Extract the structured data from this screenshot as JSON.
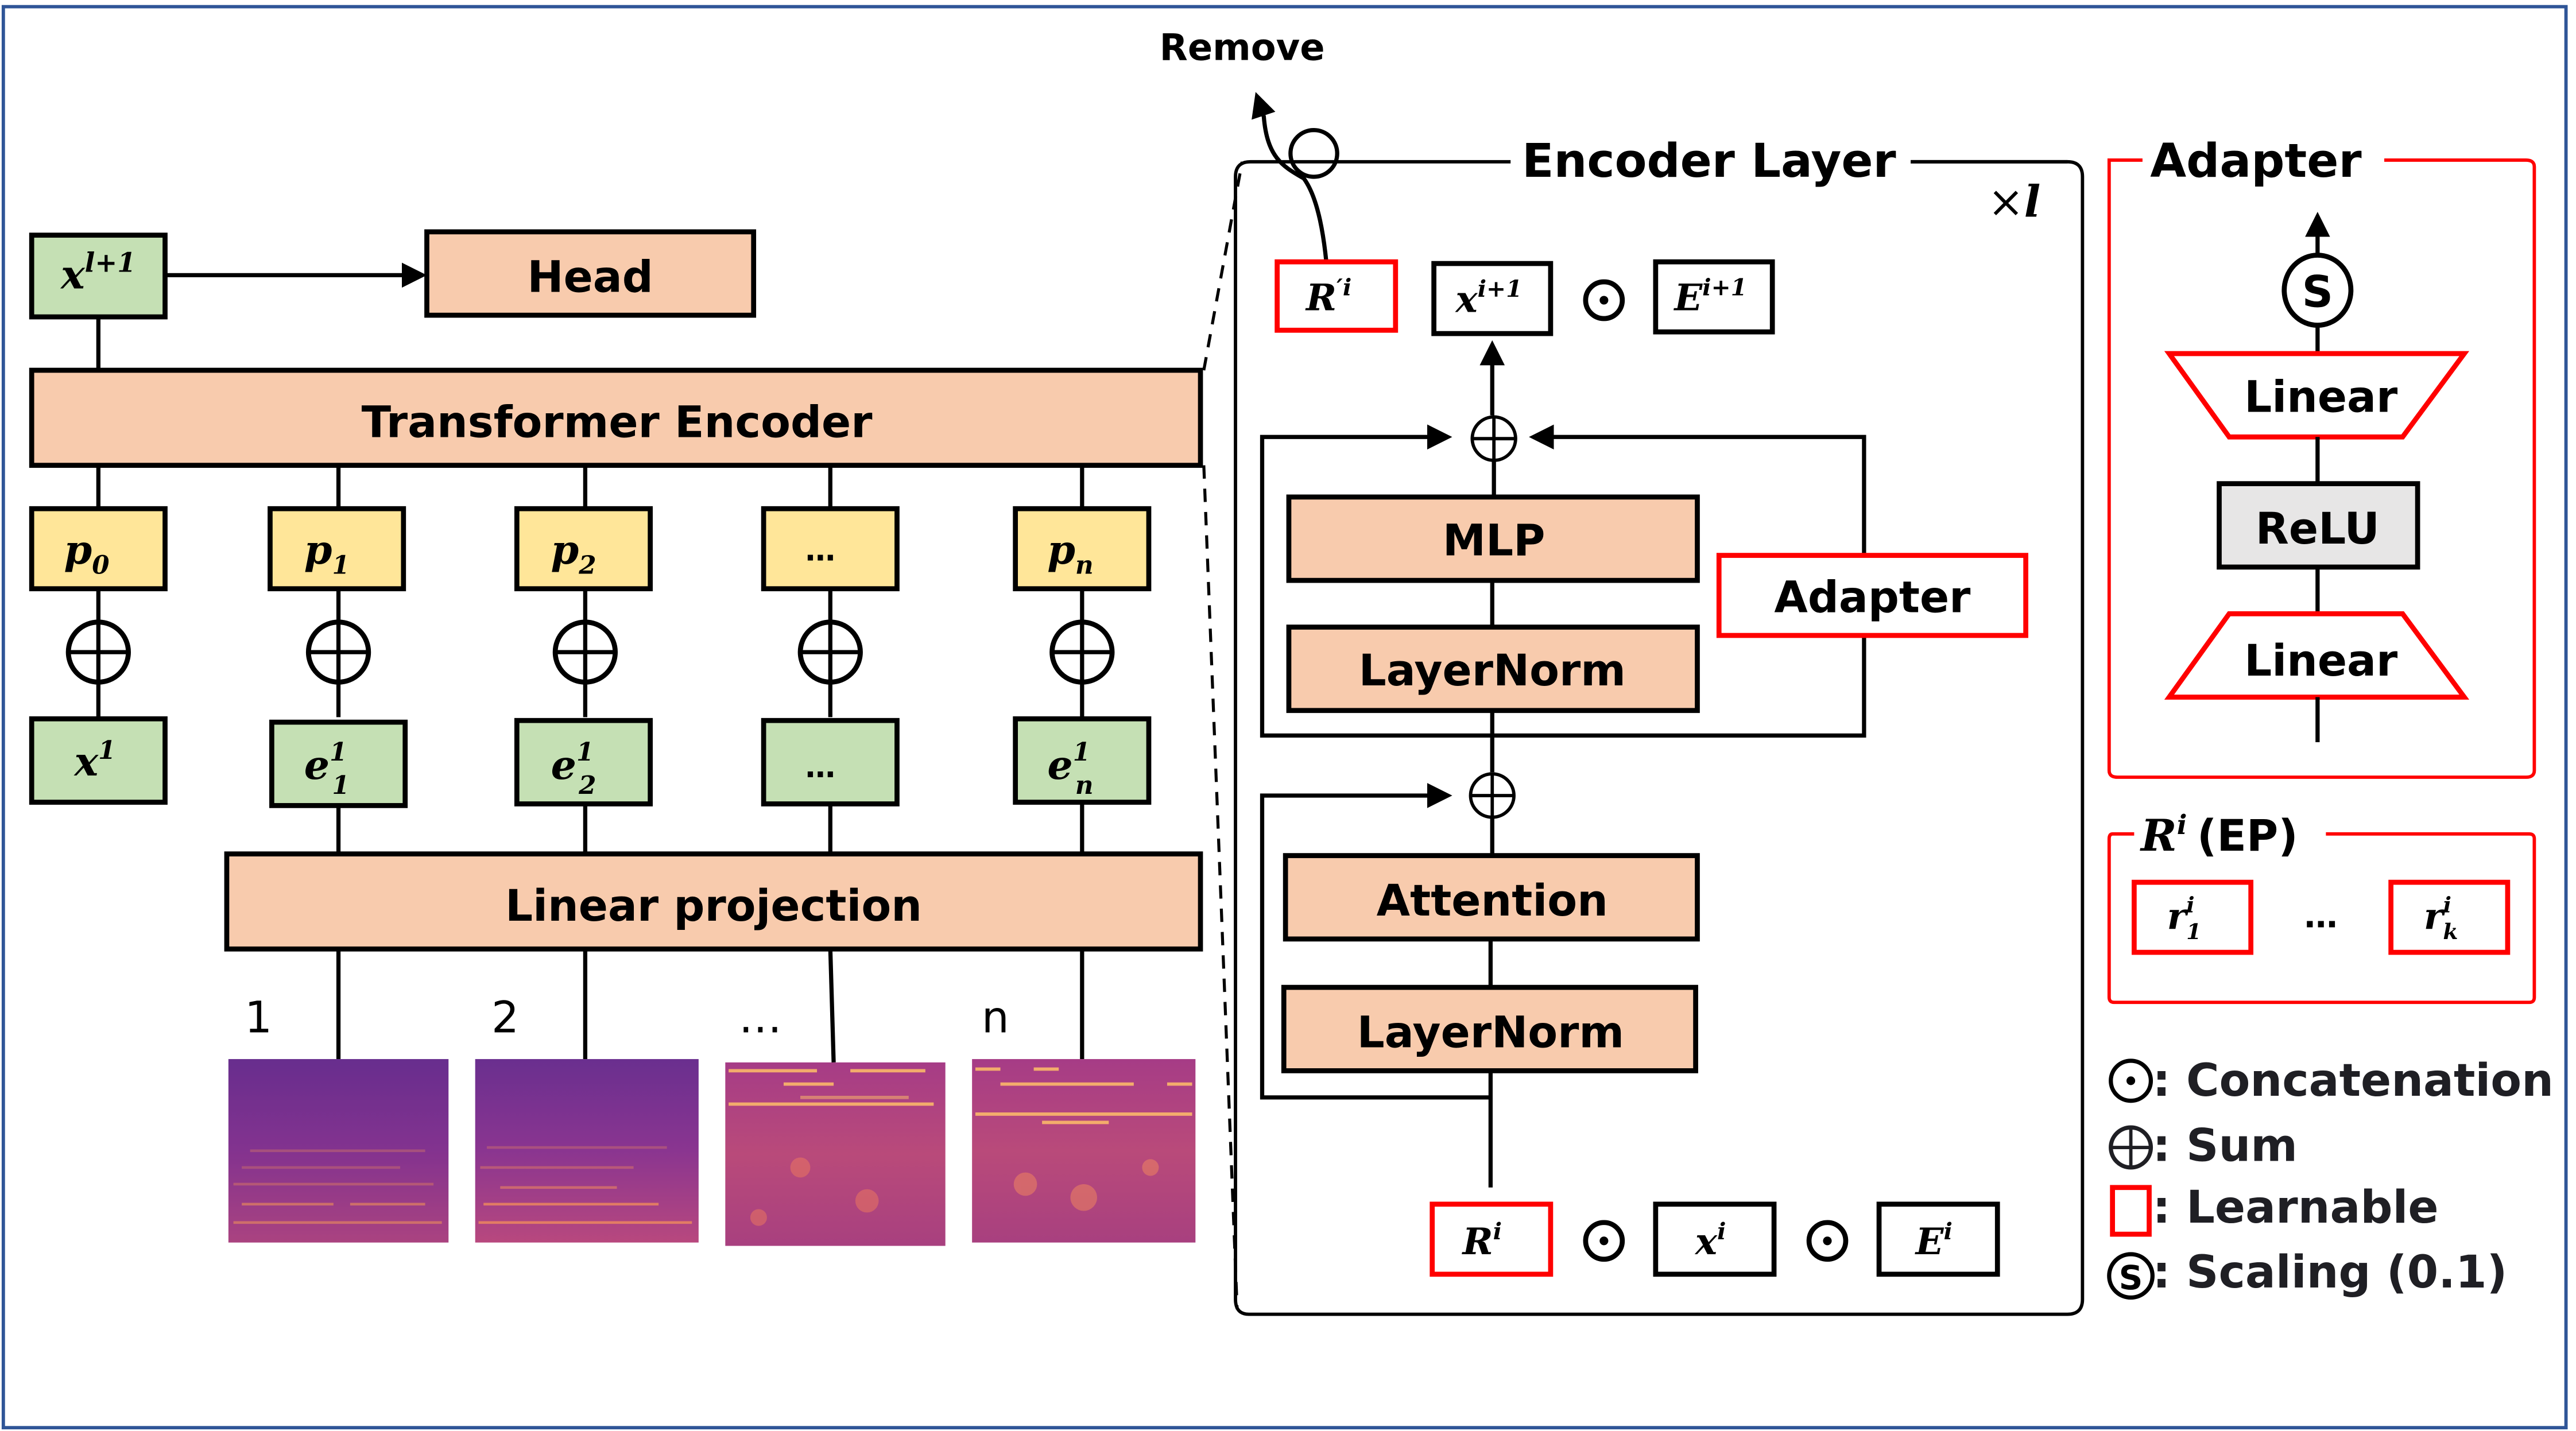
{
  "colors": {
    "frame": "#2F5597",
    "peach": "#F8CBAD",
    "green": "#C5E0B4",
    "yellow": "#FFE699",
    "learnable": "#FF0000",
    "relu": "#E7E6E6"
  },
  "left": {
    "output_token": {
      "base": "x",
      "sup": "l+1"
    },
    "head_label": "Head",
    "transformer_label": "Transformer Encoder",
    "positional": [
      {
        "base": "p",
        "sub": "0"
      },
      {
        "base": "p",
        "sub": "1"
      },
      {
        "base": "p",
        "sub": "2"
      },
      {
        "base": "…",
        "sub": ""
      },
      {
        "base": "p",
        "sub": "n"
      }
    ],
    "tokens": [
      {
        "base": "x",
        "sup": "1",
        "sub": ""
      },
      {
        "base": "e",
        "sup": "1",
        "sub": "1"
      },
      {
        "base": "e",
        "sup": "1",
        "sub": "2"
      },
      {
        "base": "…",
        "sup": "",
        "sub": ""
      },
      {
        "base": "e",
        "sup": "1",
        "sub": "n"
      }
    ],
    "projection_label": "Linear projection",
    "patch_labels": [
      "1",
      "2",
      "…",
      "n"
    ],
    "spectrogram_icons": [
      "spectrogram-patch",
      "spectrogram-patch",
      "spectrogram-patch",
      "spectrogram-patch"
    ]
  },
  "encoder": {
    "title": "Encoder Layer",
    "repeat": {
      "prefix": "×",
      "var": "l"
    },
    "remove_label": "Remove",
    "top_row": [
      {
        "base": "R",
        "sup": "′i",
        "learnable": true
      },
      {
        "base": "x",
        "sup": "i+1",
        "learnable": false
      },
      {
        "base": "E",
        "sup": "i+1",
        "learnable": false
      }
    ],
    "bottom_row": [
      {
        "base": "R",
        "sup": "i",
        "learnable": true
      },
      {
        "base": "x",
        "sup": "i",
        "learnable": false
      },
      {
        "base": "E",
        "sup": "i",
        "learnable": false
      }
    ],
    "mlp_label": "MLP",
    "layernorm_top_label": "LayerNorm",
    "adapter_label": "Adapter",
    "attention_label": "Attention",
    "layernorm_bottom_label": "LayerNorm"
  },
  "adapter_detail": {
    "title": "Adapter",
    "scaling_symbol": "S",
    "linear_up_label": "Linear",
    "relu_label": "ReLU",
    "linear_down_label": "Linear"
  },
  "ep": {
    "title_base": "R",
    "title_sup": "i",
    "title_suffix": "(EP)",
    "items": [
      {
        "base": "r",
        "sup": "i",
        "sub": "1"
      },
      {
        "base": "r",
        "sup": "i",
        "sub": "k"
      }
    ],
    "ellipsis": "…"
  },
  "legend": [
    {
      "icon": "concat-icon",
      "text": ": Concatenation"
    },
    {
      "icon": "sum-icon",
      "text": ": Sum"
    },
    {
      "icon": "learnable-icon",
      "text": ": Learnable"
    },
    {
      "icon": "scaling-icon",
      "text": ": Scaling (0.1)"
    }
  ]
}
